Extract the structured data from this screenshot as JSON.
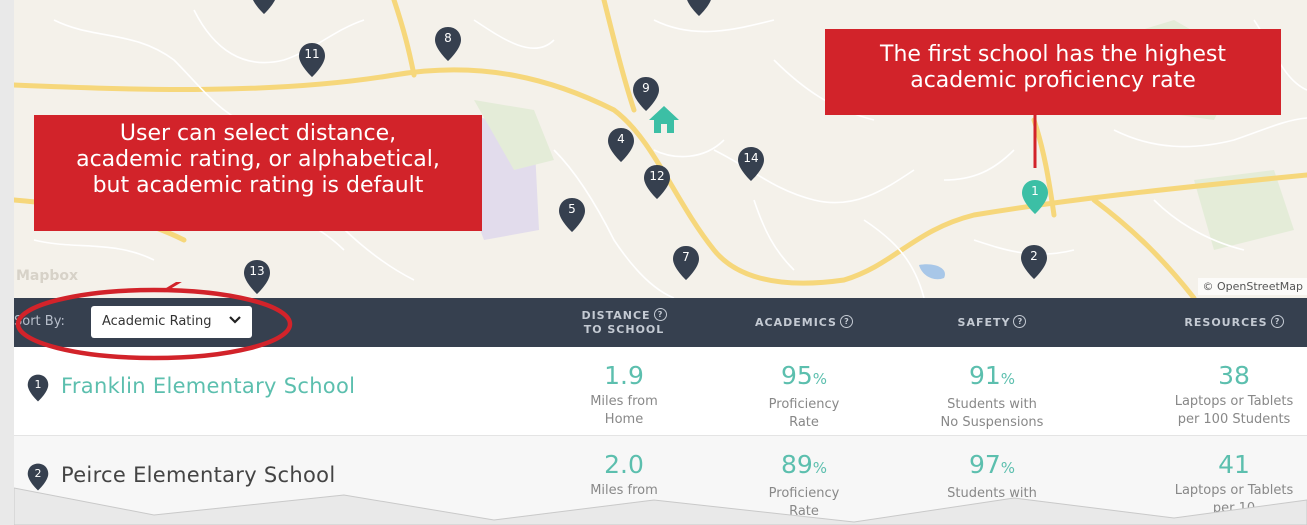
{
  "map": {
    "pins": [
      {
        "n": "11"
      },
      {
        "n": "8"
      },
      {
        "n": "9"
      },
      {
        "n": "4"
      },
      {
        "n": "14"
      },
      {
        "n": "12"
      },
      {
        "n": "5"
      },
      {
        "n": "7"
      },
      {
        "n": "13"
      },
      {
        "n": "1"
      },
      {
        "n": "2"
      }
    ],
    "attribution": "© OpenStreetMap",
    "logo": "Mapbox",
    "colors": {
      "pin": "#36404f",
      "pin_selected": "#3cbfa5",
      "home": "#3cbfa5"
    }
  },
  "annotations": {
    "right": [
      "The first school has the highest",
      "academic proficiency rate"
    ],
    "left": [
      "User can select distance,",
      "academic rating, or alphabetical,",
      "but academic rating is default"
    ],
    "accent": "#d2232a"
  },
  "header": {
    "sort_label": "Sort By:",
    "sort_value": "Academic Rating",
    "columns": {
      "distance": [
        "DISTANCE",
        "TO SCHOOL"
      ],
      "academics": "ACADEMICS",
      "safety": "SAFETY",
      "resources": "RESOURCES"
    },
    "help": "?"
  },
  "schools": [
    {
      "rank": "1",
      "name": "Franklin Elementary School",
      "distance": {
        "value": "1.9",
        "sub": [
          "Miles from",
          "Home"
        ]
      },
      "academics": {
        "value": "95",
        "unit": "%",
        "sub": [
          "Proficiency",
          "Rate"
        ]
      },
      "safety": {
        "value": "91",
        "unit": "%",
        "sub": [
          "Students with",
          "No Suspensions"
        ]
      },
      "resources": {
        "value": "38",
        "sub": [
          "Laptops or Tablets",
          "per 100 Students"
        ]
      }
    },
    {
      "rank": "2",
      "name": "Peirce Elementary School",
      "distance": {
        "value": "2.0",
        "sub": [
          "Miles from",
          ""
        ]
      },
      "academics": {
        "value": "89",
        "unit": "%",
        "sub": [
          "Proficiency",
          "Rate"
        ]
      },
      "safety": {
        "value": "97",
        "unit": "%",
        "sub": [
          "Students with",
          ""
        ]
      },
      "resources": {
        "value": "41",
        "sub": [
          "Laptops or Tablets",
          "per 10"
        ]
      }
    }
  ]
}
